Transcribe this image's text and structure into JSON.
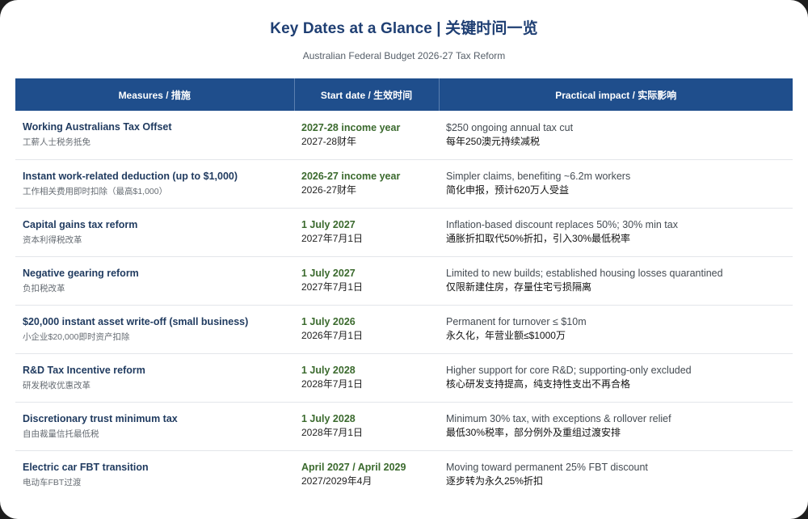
{
  "header": {
    "title": "Key Dates at a Glance  |  关键时间一览",
    "subtitle": "Australian Federal Budget 2026-27 Tax Reform"
  },
  "table": {
    "columns": [
      "Measures / 措施",
      "Start date / 生效时间",
      "Practical impact / 实际影响"
    ],
    "rows": [
      {
        "measure_en": "Working Australians Tax Offset",
        "measure_zh": "工薪人士税务抵免",
        "date_en": "2027-28 income year",
        "date_zh": "2027-28财年",
        "impact_en": "$250 ongoing annual tax cut",
        "impact_zh": "每年250澳元持续减税"
      },
      {
        "measure_en": "Instant work-related deduction (up to $1,000)",
        "measure_zh": "工作相关费用即时扣除（最高$1,000）",
        "date_en": "2026-27 income year",
        "date_zh": "2026-27财年",
        "impact_en": "Simpler claims, benefiting ~6.2m workers",
        "impact_zh": "简化申报，预计620万人受益"
      },
      {
        "measure_en": "Capital gains tax reform",
        "measure_zh": "资本利得税改革",
        "date_en": "1 July 2027",
        "date_zh": "2027年7月1日",
        "impact_en": "Inflation-based discount replaces 50%; 30% min tax",
        "impact_zh": "通胀折扣取代50%折扣，引入30%最低税率"
      },
      {
        "measure_en": "Negative gearing reform",
        "measure_zh": "负扣税改革",
        "date_en": "1 July 2027",
        "date_zh": "2027年7月1日",
        "impact_en": "Limited to new builds; established housing losses quarantined",
        "impact_zh": "仅限新建住房，存量住宅亏损隔离"
      },
      {
        "measure_en": "$20,000 instant asset write-off (small business)",
        "measure_zh": "小企业$20,000即时资产扣除",
        "date_en": "1 July 2026",
        "date_zh": "2026年7月1日",
        "impact_en": "Permanent for turnover ≤ $10m",
        "impact_zh": "永久化，年营业额≤$1000万"
      },
      {
        "measure_en": "R&D Tax Incentive reform",
        "measure_zh": "研发税收优惠改革",
        "date_en": "1 July 2028",
        "date_zh": "2028年7月1日",
        "impact_en": "Higher support for core R&D; supporting-only excluded",
        "impact_zh": "核心研发支持提高，纯支持性支出不再合格"
      },
      {
        "measure_en": "Discretionary trust minimum tax",
        "measure_zh": "自由裁量信托最低税",
        "date_en": "1 July 2028",
        "date_zh": "2028年7月1日",
        "impact_en": "Minimum 30% tax, with exceptions & rollover relief",
        "impact_zh": "最低30%税率，部分例外及重组过渡安排"
      },
      {
        "measure_en": "Electric car FBT transition",
        "measure_zh": "电动车FBT过渡",
        "date_en": "April 2027 / April 2029",
        "date_zh": "2027/2029年4月",
        "impact_en": "Moving toward permanent 25% FBT discount",
        "impact_zh": "逐步转为永久25%折扣"
      }
    ]
  }
}
